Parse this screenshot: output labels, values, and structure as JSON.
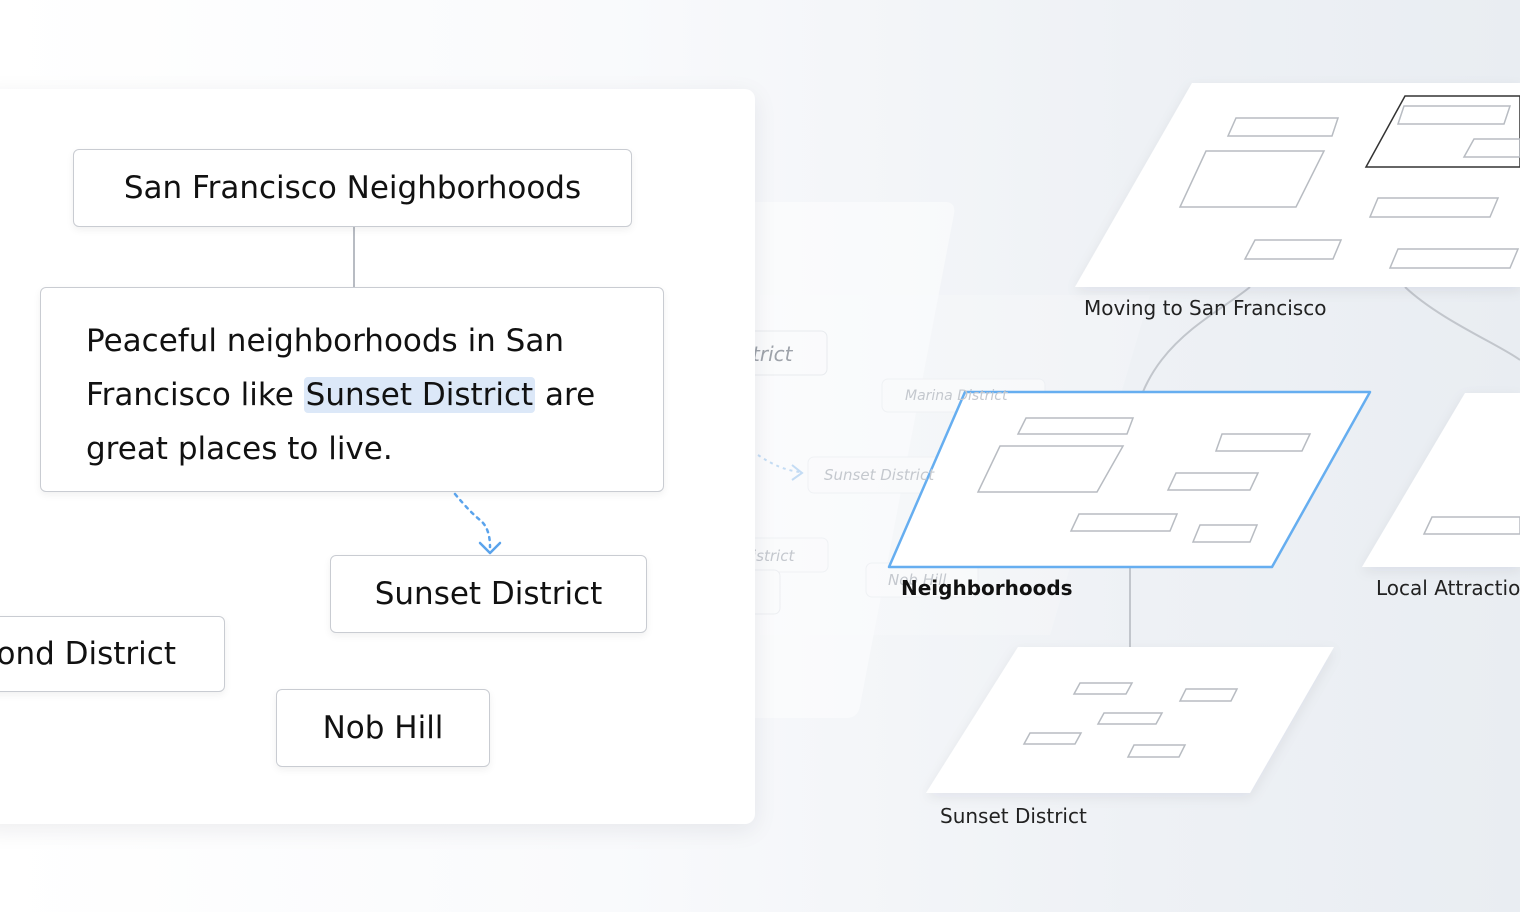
{
  "left_panel": {
    "title_node": "San Francisco Neighborhoods",
    "note": {
      "before": "Peaceful neighborhoods in San",
      "line2_start": "Francisco like ",
      "highlight": "Sunset District",
      "line2_end": " are",
      "line3": "great places to live."
    },
    "nodes": {
      "sunset": "Sunset District",
      "richmond": "ond District",
      "nob_hill": "Nob Hill"
    }
  },
  "ghost_layer": {
    "labels": [
      "trict",
      "Marina District",
      "Sunset District",
      "istrict",
      "Nob Hill"
    ]
  },
  "map": {
    "labels": {
      "top": "Moving to San Francisco",
      "middle": "Neighborhoods",
      "right": "Local Attractio",
      "bottom": "Sunset District"
    },
    "colors": {
      "accent": "#66aef0",
      "arrow": "#5aa3ec",
      "connector": "#c2c6cc"
    }
  }
}
